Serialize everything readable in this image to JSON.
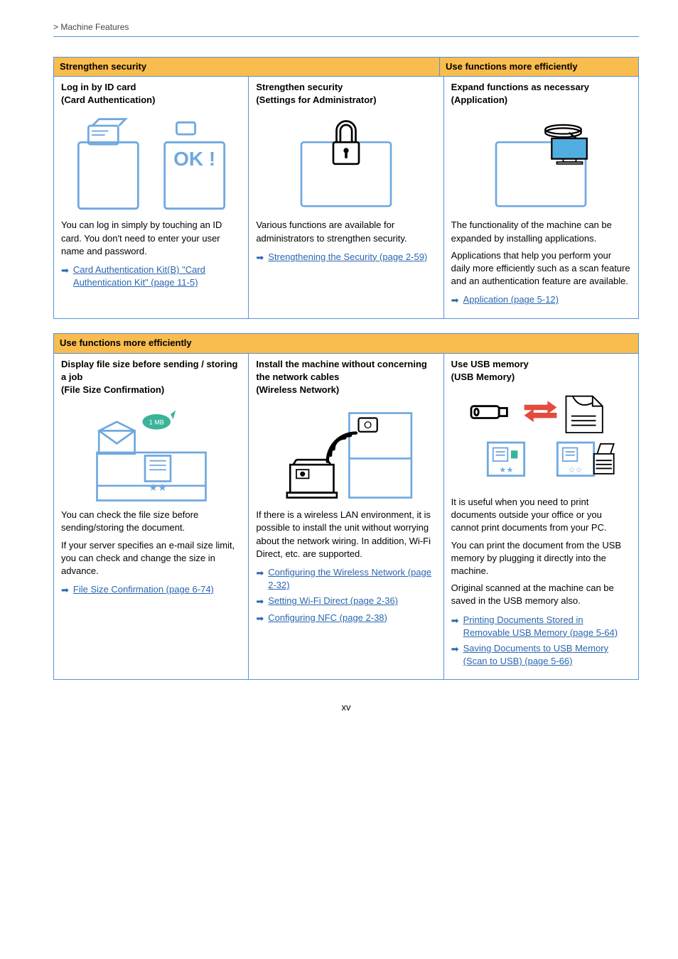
{
  "breadcrumb": "> Machine Features",
  "pagenum": "xv",
  "box1": {
    "header_left": "Strengthen security",
    "header_right": "Use functions more efficiently",
    "c1": {
      "title_l1": "Log in by ID card",
      "title_l2": "(Card Authentication)",
      "ok_text": "OK !",
      "desc": "You can log in simply by touching an ID card. You don't need to enter your user name and password.",
      "link": "Card Authentication Kit(B) \"Card Authentication Kit\" (page 11-5)"
    },
    "c2": {
      "title_l1": "Strengthen security",
      "title_l2": "(Settings for Administrator)",
      "desc": "Various functions are available for administrators to strengthen security.",
      "link": "Strengthening the Security (page 2-59)"
    },
    "c3": {
      "title_l1": "Expand functions as necessary",
      "title_l2": "(Application)",
      "desc1": "The functionality of the machine can be expanded by installing applications.",
      "desc2": "Applications that help you perform your daily more efficiently such as a scan feature and an authentication feature are available.",
      "link": "Application (page 5-12)"
    }
  },
  "box2": {
    "header": "Use functions more efficiently",
    "c1": {
      "title_l1": "Display file size before sending / storing a job",
      "title_l2": "(File Size Confirmation)",
      "badge": "1 MB",
      "desc1": "You can check the file size before sending/storing the document.",
      "desc2": "If your server specifies an e-mail size limit, you can check and change the size in advance.",
      "link": "File Size Confirmation (page 6-74)"
    },
    "c2": {
      "title_l1": "Install the machine without concerning the network cables",
      "title_l2": "(Wireless Network)",
      "desc": "If there is a wireless LAN environment, it is possible to install the unit without worrying about the network wiring. In addition, Wi-Fi Direct, etc. are supported.",
      "link1": "Configuring the Wireless Network (page 2-32)",
      "link2": "Setting Wi-Fi Direct (page 2-36)",
      "link3": "Configuring NFC (page 2-38)"
    },
    "c3": {
      "title_l1": "Use USB memory",
      "title_l2": "(USB Memory)",
      "desc1": "It is useful when you need to print documents outside your office or you cannot print documents from your PC.",
      "desc2": "You can print the document from the USB memory by plugging it directly into the machine.",
      "desc3": "Original scanned at the machine can be saved in the USB memory also.",
      "link1": "Printing Documents Stored in Removable USB Memory (page 5-64)",
      "link2": "Saving Documents to USB Memory (Scan to USB) (page 5-66)"
    }
  }
}
